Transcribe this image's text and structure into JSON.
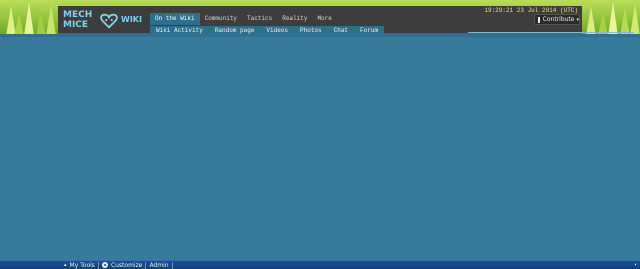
{
  "logo": {
    "line1": "MECH",
    "line2": "MICE",
    "wiki": "WIKI"
  },
  "nav": {
    "tabs": [
      {
        "label": "On the Wiki",
        "active": true
      },
      {
        "label": "Community",
        "active": false
      },
      {
        "label": "Tactics",
        "active": false
      },
      {
        "label": "Reality",
        "active": false
      },
      {
        "label": "More",
        "active": false
      }
    ],
    "subnav": [
      "Wiki Activity",
      "Random page",
      "Videos",
      "Photos",
      "Chat",
      "Forum"
    ]
  },
  "clock": "19:29:21 23 Jul 2014 (UTC)",
  "contribute": {
    "label": "Contribute",
    "icon": "page-icon"
  },
  "toolbar": {
    "my_tools": "My Tools",
    "customize": "Customize",
    "admin": "Admin",
    "customize_icon": "gear-icon",
    "collapse_icon": "chevron-up-icon"
  },
  "colors": {
    "page_background": "#367a9c",
    "header_background": "#3d3d3d",
    "accent": "#2f6f8e",
    "clock_text": "#f3e17a",
    "toolbar_background": "#1b4f92"
  }
}
